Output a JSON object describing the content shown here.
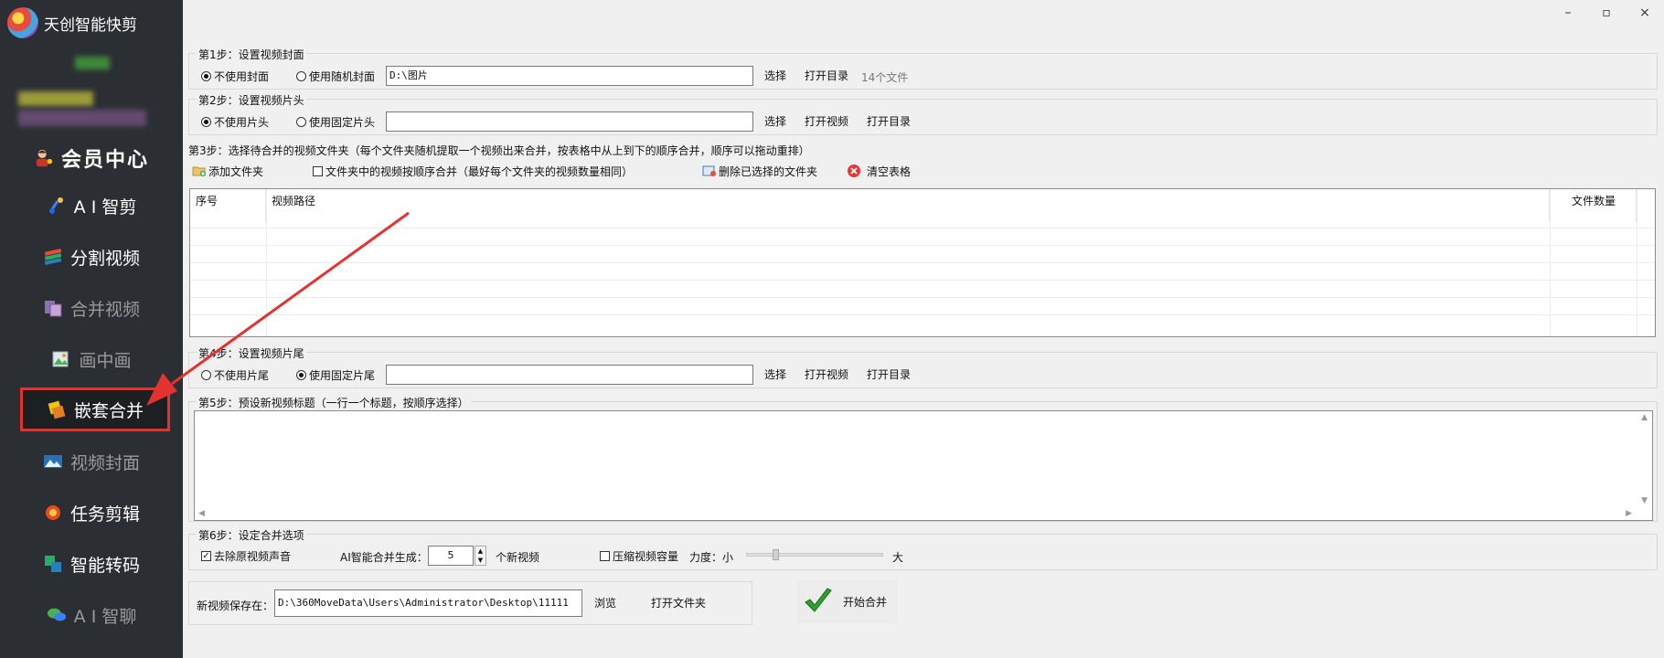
{
  "app": {
    "title": "天创智能快剪"
  },
  "window": {
    "minimize": "–",
    "maximize": "▫",
    "close": "×"
  },
  "sidebar": {
    "items": [
      {
        "label": "会员中心",
        "icon": "vip-user-icon"
      },
      {
        "label": "A I 智剪",
        "icon": "ai-edit-icon"
      },
      {
        "label": "分割视频",
        "icon": "split-video-icon"
      },
      {
        "label": "合并视频",
        "icon": "merge-video-icon"
      },
      {
        "label": "画中画",
        "icon": "picture-in-picture-icon"
      },
      {
        "label": "嵌套合并",
        "icon": "nested-merge-icon"
      },
      {
        "label": "视频封面",
        "icon": "video-cover-icon"
      },
      {
        "label": "任务剪辑",
        "icon": "task-edit-icon"
      },
      {
        "label": "智能转码",
        "icon": "transcode-icon"
      },
      {
        "label": "A I 智聊",
        "icon": "ai-chat-icon"
      }
    ]
  },
  "step1": {
    "legend": "第1步：设置视频封面",
    "opt_none": "不使用封面",
    "opt_random": "使用随机封面",
    "path": "D:\\图片",
    "select": "选择",
    "open_dir": "打开目录",
    "count": "14个文件"
  },
  "step2": {
    "legend": "第2步：设置视频片头",
    "opt_none": "不使用片头",
    "opt_fixed": "使用固定片头",
    "path": "",
    "select": "选择",
    "open_video": "打开视频",
    "open_dir": "打开目录"
  },
  "step3": {
    "title": "第3步：选择待合并的视频文件夹（每个文件夹随机提取一个视频出来合并，按表格中从上到下的顺序合并，顺序可以拖动重排）",
    "add_folder": "添加文件夹",
    "in_order": "文件夹中的视频按顺序合并（最好每个文件夹的视频数量相同）",
    "delete_selected": "删除已选择的文件夹",
    "clear_table": "清空表格",
    "columns": [
      "序号",
      "视频路径",
      "文件数量"
    ]
  },
  "step4": {
    "legend": "第4步：设置视频片尾",
    "opt_none": "不使用片尾",
    "opt_fixed": "使用固定片尾",
    "path": "",
    "select": "选择",
    "open_video": "打开视频",
    "open_dir": "打开目录"
  },
  "step5": {
    "legend": "第5步：预设新视频标题（一行一个标题，按顺序选择）",
    "text": ""
  },
  "step6": {
    "legend": "第6步：设定合并选项",
    "remove_audio": "去除原视频声音",
    "ai_gen_label": "AI智能合并生成：",
    "ai_gen_value": "5",
    "ai_gen_suffix": "个新视频",
    "compress": "压缩视频容量",
    "strength_label": "力度：小",
    "strength_max": "大",
    "strength_level": 0.2
  },
  "output": {
    "label": "新视频保存在：",
    "path": "D:\\360MoveData\\Users\\Administrator\\Desktop\\11111",
    "browse": "浏览",
    "open_folder": "打开文件夹"
  },
  "start": {
    "label": "开始合并"
  }
}
